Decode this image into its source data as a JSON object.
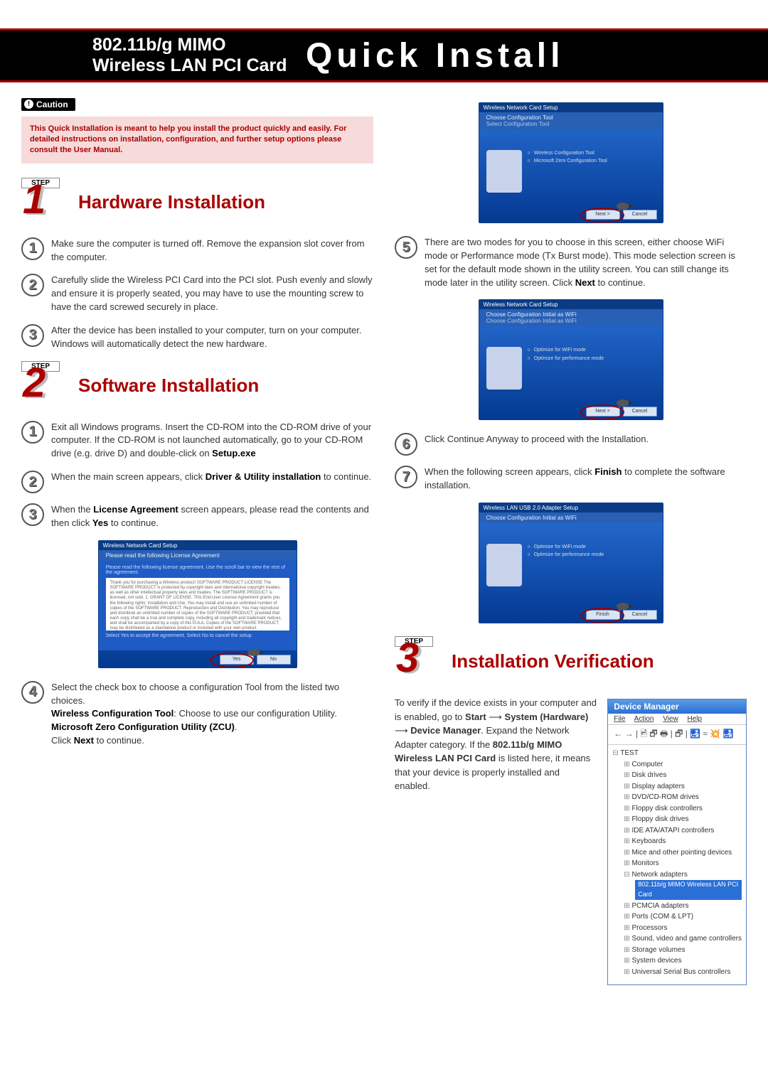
{
  "header": {
    "left_line1": "802.11b/g MIMO",
    "left_line2": "Wireless LAN PCI Card",
    "right": "Quick Install"
  },
  "caution": {
    "tag": "Caution",
    "text": "This Quick Installation is meant to help you install the product quickly and easily. For detailed instructions on installation, configuration, and further setup options please consult the User Manual."
  },
  "step_label": "STEP",
  "sections": {
    "s1": {
      "num": "1",
      "title": "Hardware Installation"
    },
    "s2": {
      "num": "2",
      "title": "Software Installation"
    },
    "s3": {
      "num": "3",
      "title": "Installation Verification"
    }
  },
  "hw": {
    "i1": "Make sure the computer is turned off. Remove the expansion slot cover from the computer.",
    "i2": "Carefully slide the Wireless PCI Card into the PCI slot. Push evenly and slowly and ensure it is properly seated, you may have to use the mounting screw to have the card screwed securely in place.",
    "i3": "After the device has been installed to your computer, turn on your computer. Windows will automatically detect the new hardware."
  },
  "sw": {
    "i1_a": "Exit all Windows programs. Insert the CD-ROM into the CD-ROM drive of your computer. If the CD-ROM is not launched automatically, go to your CD-ROM drive (e.g. drive D) and double-click on ",
    "i1_b": "Setup.exe",
    "i2_a": "When the main screen appears, click ",
    "i2_b": "Driver & Utility installation",
    "i2_c": " to continue.",
    "i3_a": "When the ",
    "i3_b": "License Agreement",
    "i3_c": " screen appears, please read the contents and then click ",
    "i3_d": "Yes",
    "i3_e": " to continue.",
    "i4_a": "Select the check box to choose a configuration Tool from the listed two choices.",
    "i4_b": "Wireless Configuration Tool",
    "i4_c": ": Choose to use our configuration Utility.",
    "i4_d": "Microsoft Zero Configuration Utility (ZCU)",
    "i4_e": ".",
    "i4_f": "Click ",
    "i4_g": "Next",
    "i4_h": " to continue.",
    "i5_a": "There are two modes for you to choose in this screen, either choose WiFi mode or Performance mode (Tx Burst mode). This mode selection screen is set for the default mode shown in the utility screen. You can still change its mode later in the utility screen. Click ",
    "i5_b": "Next",
    "i5_c": " to continue.",
    "i6": "Click Continue Anyway to proceed with the Installation.",
    "i7_a": "When the following screen appears, click ",
    "i7_b": "Finish",
    "i7_c": " to complete the software installation."
  },
  "verify": {
    "text_a": "To verify if the device exists in your computer and is enabled, go to ",
    "start": "Start",
    "arrow": " ⟶ ",
    "sys": "System (Hardware)",
    "dm": "Device Manager",
    "text_b": ". Expand the Network Adapter category. If the ",
    "card": "802.11b/g MIMO Wireless LAN PCI Card",
    "text_c": " is listed here, it means that your device is properly installed and enabled."
  },
  "screenshot": {
    "lic_window_title": "Wireless Network Card Setup",
    "lic_header": "Please read the following License Agreement",
    "lic_sub": "Please read the following license agreement. Use the scroll bar to view the rest of the agreement.",
    "lic_text": "Thank you for purchasing a Wireless product!\n\nSOFTWARE PRODUCT LICENSE\nThe SOFTWARE PRODUCT is protected by copyright laws and international copyright treaties, as well as other intellectual property laws and treaties. The SOFTWARE PRODUCT is licensed, not sold.\n\n1. GRANT OF LICENSE. This End-User License Agreement grants you the following rights: Installation and Use. You may install and use an unlimited number of copies of the SOFTWARE PRODUCT.\n\nReproduction and Distribution. You may reproduce and distribute an unlimited number of copies of the SOFTWARE PRODUCT; provided that each copy shall be a true and complete copy, including all copyright and trademark notices, and shall be accompanied by a copy of this EULA. Copies of the SOFTWARE PRODUCT may be distributed as a standalone product or included with your own product.",
    "lic_accept": "Select Yes to accept the agreement.\nSelect No to cancel the setup.",
    "btn_yes": "Yes",
    "btn_no": "No",
    "cfg_title": "Wireless Network Card Setup",
    "cfg_head": "Choose Configuration Tool",
    "cfg_sub": "Select Configuration Tool",
    "cfg_opt1": "Wireless Configuration Tool",
    "cfg_opt2": "Microsoft Zero Configuration Tool",
    "btn_next": "Next >",
    "btn_cancel": "Cancel",
    "mode_head": "Choose Configuration Initial as WiFi",
    "mode_sub": "Choose Configuration Initial as WiFi",
    "mode_opt1": "Optimize for WiFi mode",
    "mode_opt2": "Optimize for performance mode",
    "fin_title": "Wireless LAN USB 2.0 Adapter Setup",
    "fin_head": "Choose Configuration Initial as WiFi",
    "fin_opt1": "Optimize for WiFi mode",
    "fin_opt2": "Optimize for performance mode",
    "btn_finish": "Finish"
  },
  "dm_panel": {
    "title": "Device Manager",
    "menu": [
      "File",
      "Action",
      "View",
      "Help"
    ],
    "toolbar": "← → | 🖻 🗗 🖶 | 🗗 | 🛃 ≈ 💥 🛃",
    "items": [
      "TEST",
      "Computer",
      "Disk drives",
      "Display adapters",
      "DVD/CD-ROM drives",
      "Floppy disk controllers",
      "Floppy disk drives",
      "IDE ATA/ATAPI controllers",
      "Keyboards",
      "Mice and other pointing devices",
      "Monitors",
      "Network adapters",
      "802.11b/g MIMO Wireless LAN PCI Card",
      "PCMCIA adapters",
      "Ports (COM & LPT)",
      "Processors",
      "Sound, video and game controllers",
      "Storage volumes",
      "System devices",
      "Universal Serial Bus controllers"
    ]
  }
}
